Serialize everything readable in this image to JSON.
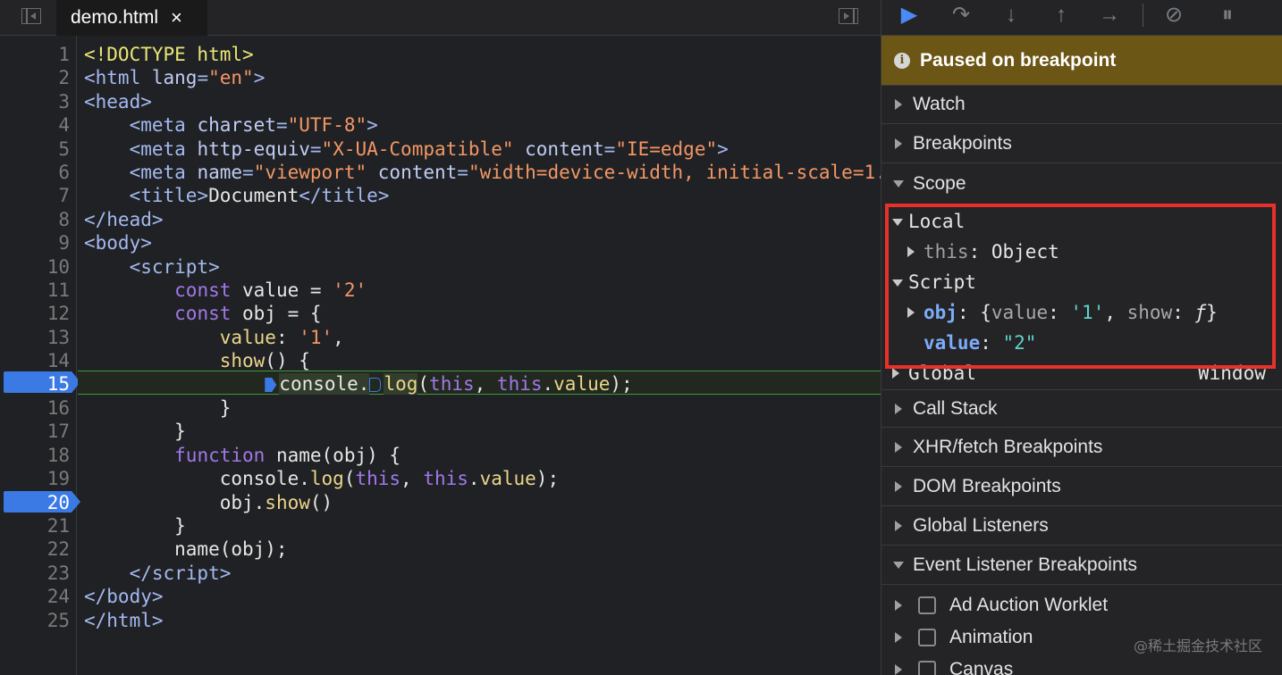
{
  "editor": {
    "file_tab": {
      "name": "demo.html",
      "close": "×"
    },
    "line_numbers": [
      "1",
      "2",
      "3",
      "4",
      "5",
      "6",
      "7",
      "8",
      "9",
      "10",
      "11",
      "12",
      "13",
      "14",
      "15",
      "16",
      "17",
      "18",
      "19",
      "20",
      "21",
      "22",
      "23",
      "24",
      "25"
    ],
    "breakpoint_lines": [
      "15",
      "20"
    ],
    "current_line": "15"
  },
  "debugger": {
    "toolbar": {
      "resume": "▶",
      "step_over": "↷",
      "step_into": "↓",
      "step_out": "↑",
      "step": "→",
      "deactivate_breakpoints": "⊘",
      "pause_on_exceptions": "⏸"
    },
    "paused_banner": {
      "icon": "i",
      "text": "Paused on breakpoint"
    },
    "sections": {
      "watch": "Watch",
      "breakpoints": "Breakpoints",
      "scope": "Scope",
      "call_stack": "Call Stack",
      "xhr": "XHR/fetch Breakpoints",
      "dom": "DOM Breakpoints",
      "global_listeners": "Global Listeners",
      "event_listener_breakpoints": "Event Listener Breakpoints"
    },
    "scope": {
      "local": "Local",
      "this_key": "this",
      "this_val": "Object",
      "script": "Script",
      "obj_key": "obj",
      "obj_preview_open": "{",
      "obj_prop1_key": "value",
      "obj_prop1_val": "'1'",
      "obj_prop2_key": "show",
      "obj_prop2_val": "ƒ",
      "obj_preview_close": "}",
      "value_key": "value",
      "value_val": "\"2\"",
      "global": "Global",
      "global_val": "Window"
    },
    "event_listeners": [
      "Ad Auction Worklet",
      "Animation",
      "Canvas"
    ]
  },
  "watermark": "@稀土掘金技术社区",
  "colors": {
    "breakpoint": "#3b7ae5",
    "paused_banner": "#6b5615",
    "highlight_box": "#e8312a",
    "exec_line_border": "#3d9a3d"
  }
}
